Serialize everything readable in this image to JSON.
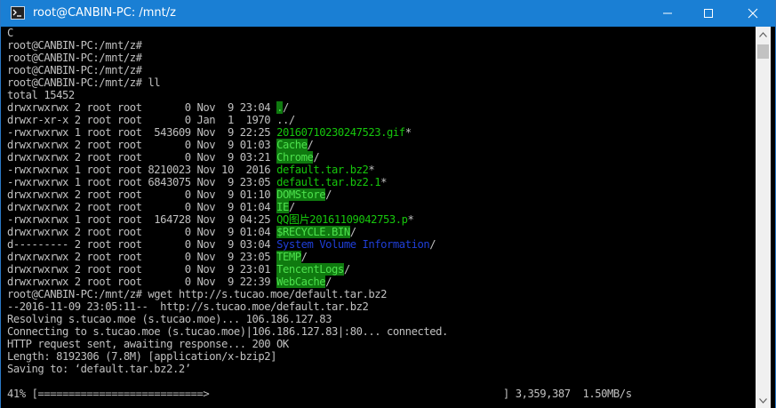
{
  "window": {
    "title": "root@CANBIN-PC: /mnt/z",
    "icon": "terminal-icon",
    "controls": [
      "minimize-icon",
      "maximize-icon",
      "close-icon"
    ]
  },
  "colors": {
    "titlebar": "#1a7fd4",
    "terminal_bg": "#000000",
    "text": "#c0c0c0",
    "executable": "#16c60c",
    "dir_highlight": "#0f7a0f",
    "system_dir": "#1f3fd9"
  },
  "terminal": {
    "lines": [
      "C",
      "root@CANBIN-PC:/mnt/z#",
      "root@CANBIN-PC:/mnt/z#",
      "root@CANBIN-PC:/mnt/z#",
      "root@CANBIN-PC:/mnt/z# ll",
      "total 15452"
    ],
    "listing": [
      {
        "perm": "drwxrwxrwx",
        "links": "2",
        "owner": "root",
        "group": "root",
        "size": "0",
        "month": "Nov",
        "day": "9",
        "time": "23:04",
        "name": ".",
        "suffix": "/"
      },
      {
        "perm": "drwxr-xr-x",
        "links": "2",
        "owner": "root",
        "group": "root",
        "size": "0",
        "month": "Jan",
        "day": "1",
        "time": "1970",
        "name": "..",
        "suffix": "/"
      },
      {
        "perm": "-rwxrwxrwx",
        "links": "1",
        "owner": "root",
        "group": "root",
        "size": "543609",
        "month": "Nov",
        "day": "9",
        "time": "22:25",
        "name": "20160710230247523.gif",
        "suffix": "*"
      },
      {
        "perm": "drwxrwxrwx",
        "links": "2",
        "owner": "root",
        "group": "root",
        "size": "0",
        "month": "Nov",
        "day": "9",
        "time": "01:03",
        "name": "Cache",
        "suffix": "/"
      },
      {
        "perm": "drwxrwxrwx",
        "links": "2",
        "owner": "root",
        "group": "root",
        "size": "0",
        "month": "Nov",
        "day": "9",
        "time": "03:21",
        "name": "Chrome",
        "suffix": "/"
      },
      {
        "perm": "-rwxrwxrwx",
        "links": "1",
        "owner": "root",
        "group": "root",
        "size": "8210023",
        "month": "Nov",
        "day": "10",
        "time": "2016",
        "name": "default.tar.bz2",
        "suffix": "*"
      },
      {
        "perm": "-rwxrwxrwx",
        "links": "1",
        "owner": "root",
        "group": "root",
        "size": "6843075",
        "month": "Nov",
        "day": "9",
        "time": "23:05",
        "name": "default.tar.bz2.1",
        "suffix": "*"
      },
      {
        "perm": "drwxrwxrwx",
        "links": "2",
        "owner": "root",
        "group": "root",
        "size": "0",
        "month": "Nov",
        "day": "9",
        "time": "01:10",
        "name": "DOMStore",
        "suffix": "/"
      },
      {
        "perm": "drwxrwxrwx",
        "links": "2",
        "owner": "root",
        "group": "root",
        "size": "0",
        "month": "Nov",
        "day": "9",
        "time": "01:04",
        "name": "IE",
        "suffix": "/"
      },
      {
        "perm": "-rwxrwxrwx",
        "links": "1",
        "owner": "root",
        "group": "root",
        "size": "164728",
        "month": "Nov",
        "day": "9",
        "time": "04:25",
        "name": "QQ图片20161109042753.p",
        "suffix": "*"
      },
      {
        "perm": "drwxrwxrwx",
        "links": "2",
        "owner": "root",
        "group": "root",
        "size": "0",
        "month": "Nov",
        "day": "9",
        "time": "01:04",
        "name": "$RECYCLE.BIN",
        "suffix": "/"
      },
      {
        "perm": "d---------",
        "links": "2",
        "owner": "root",
        "group": "root",
        "size": "0",
        "month": "Nov",
        "day": "9",
        "time": "03:04",
        "name": "System Volume Information",
        "suffix": "/"
      },
      {
        "perm": "drwxrwxrwx",
        "links": "2",
        "owner": "root",
        "group": "root",
        "size": "0",
        "month": "Nov",
        "day": "9",
        "time": "23:05",
        "name": "TEMP",
        "suffix": "/"
      },
      {
        "perm": "drwxrwxrwx",
        "links": "2",
        "owner": "root",
        "group": "root",
        "size": "0",
        "month": "Nov",
        "day": "9",
        "time": "23:01",
        "name": "TencentLogs",
        "suffix": "/"
      },
      {
        "perm": "drwxrwxrwx",
        "links": "2",
        "owner": "root",
        "group": "root",
        "size": "0",
        "month": "Nov",
        "day": "9",
        "time": "22:39",
        "name": "WebCache",
        "suffix": "/"
      }
    ],
    "wget_lines": [
      "root@CANBIN-PC:/mnt/z# wget http://s.tucao.moe/default.tar.bz2",
      "--2016-11-09 23:05:11--  http://s.tucao.moe/default.tar.bz2",
      "Resolving s.tucao.moe (s.tucao.moe)... 106.186.127.83",
      "Connecting to s.tucao.moe (s.tucao.moe)|106.186.127.83|:80... connected.",
      "HTTP request sent, awaiting response... 200 OK",
      "Length: 8192306 (7.8M) [application/x-bzip2]",
      "Saving to: ‘default.tar.bz2.2’",
      ""
    ],
    "progress": {
      "percent_text": "41%",
      "bar": "[===========================>",
      "bar_end": "]",
      "bytes": "3,359,387",
      "rate": "1.50MB/s"
    }
  }
}
